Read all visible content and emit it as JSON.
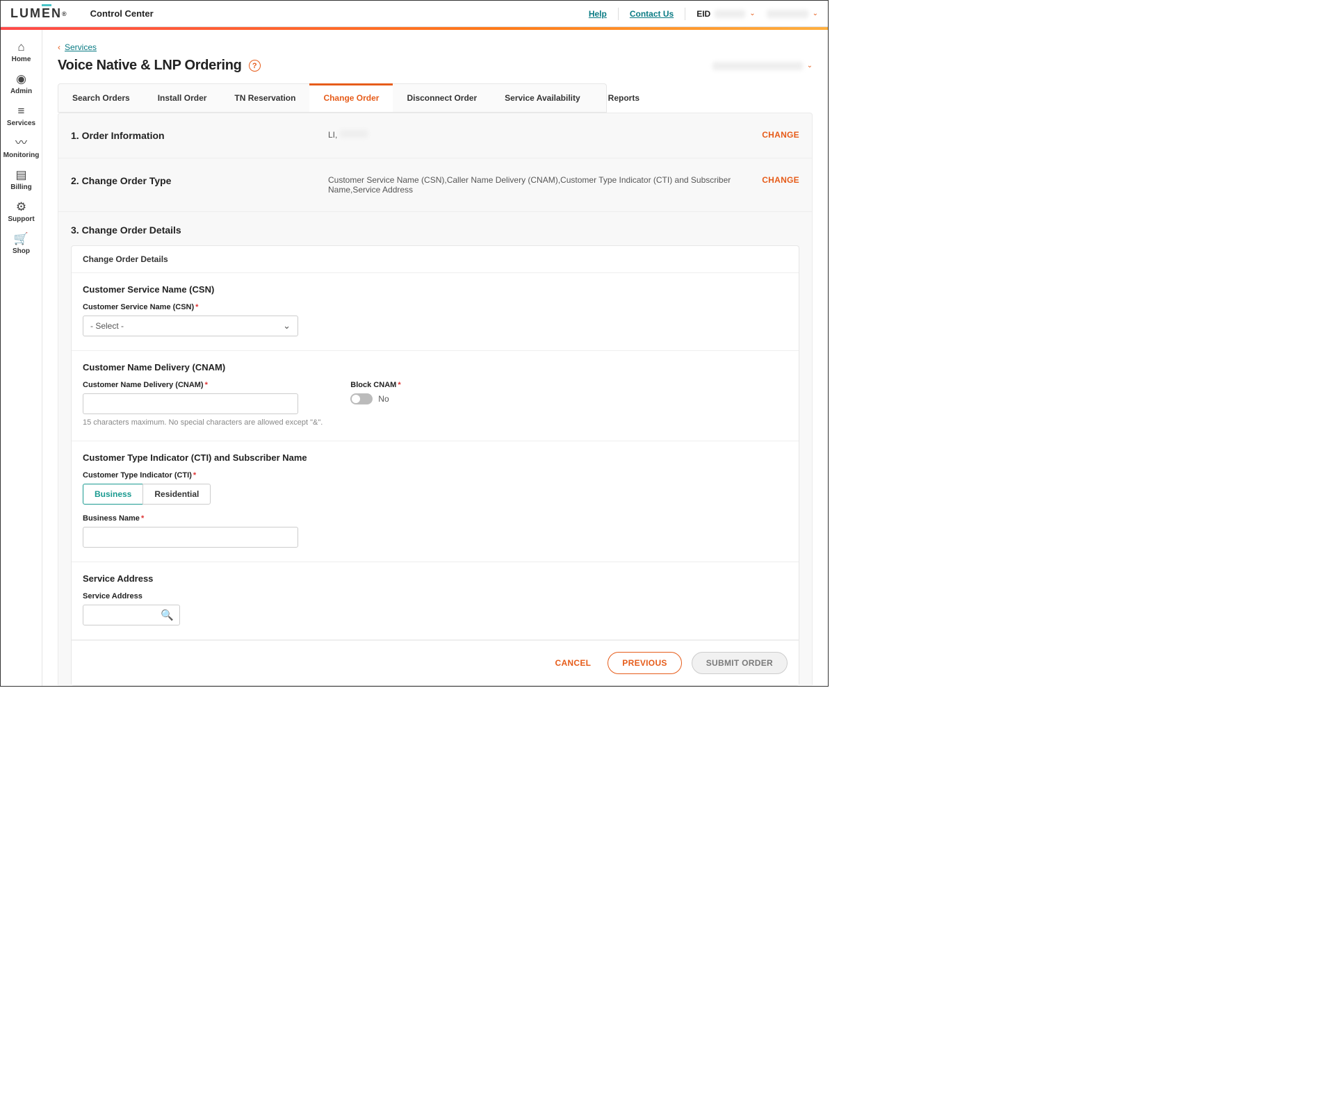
{
  "header": {
    "logo_text_before": "LUM",
    "logo_text_bar": "E",
    "logo_text_after": "N",
    "logo_suffix": "®",
    "app_name": "Control Center",
    "help_label": "Help",
    "contact_label": "Contact Us",
    "eid_label": "EID"
  },
  "sidebar": {
    "items": [
      {
        "icon": "⌂",
        "label": "Home"
      },
      {
        "icon": "◉",
        "label": "Admin"
      },
      {
        "icon": "≡",
        "label": "Services"
      },
      {
        "icon": "〰",
        "label": "Monitoring"
      },
      {
        "icon": "▤",
        "label": "Billing"
      },
      {
        "icon": "⚙",
        "label": "Support"
      },
      {
        "icon": "🛒",
        "label": "Shop"
      }
    ]
  },
  "breadcrumb": {
    "back_glyph": "‹",
    "link_label": "Services"
  },
  "page_title": "Voice Native & LNP Ordering",
  "tabs": [
    {
      "label": "Search Orders",
      "active": false
    },
    {
      "label": "Install Order",
      "active": false
    },
    {
      "label": "TN Reservation",
      "active": false
    },
    {
      "label": "Change Order",
      "active": true
    },
    {
      "label": "Disconnect Order",
      "active": false
    },
    {
      "label": "Service Availability",
      "active": false
    },
    {
      "label": "Reports",
      "active": false
    }
  ],
  "sections": {
    "s1_title": "1. Order Information",
    "s1_value_prefix": "LI,",
    "s2_title": "2. Change Order Type",
    "s2_value": "Customer Service Name (CSN),Caller Name Delivery (CNAM),Customer Type Indicator (CTI) and Subscriber Name,Service Address",
    "change_label": "CHANGE",
    "s3_title": "3. Change Order Details"
  },
  "details": {
    "panel_heading": "Change Order Details",
    "csn_block_title": "Customer Service Name (CSN)",
    "csn_field_label": "Customer Service Name (CSN)",
    "csn_select_placeholder": "- Select -",
    "cnam_block_title": "Customer Name Delivery (CNAM)",
    "cnam_field_label": "Customer Name Delivery (CNAM)",
    "cnam_hint": "15 characters maximum. No special characters are allowed except \"&\".",
    "block_cnam_label": "Block CNAM",
    "block_cnam_value": "No",
    "cti_block_title": "Customer Type Indicator (CTI) and Subscriber Name",
    "cti_field_label": "Customer Type Indicator (CTI)",
    "cti_option_business": "Business",
    "cti_option_residential": "Residential",
    "business_name_label": "Business Name",
    "addr_block_title": "Service Address",
    "addr_field_label": "Service Address"
  },
  "footer": {
    "cancel": "CANCEL",
    "previous": "PREVIOUS",
    "submit": "SUBMIT ORDER"
  }
}
